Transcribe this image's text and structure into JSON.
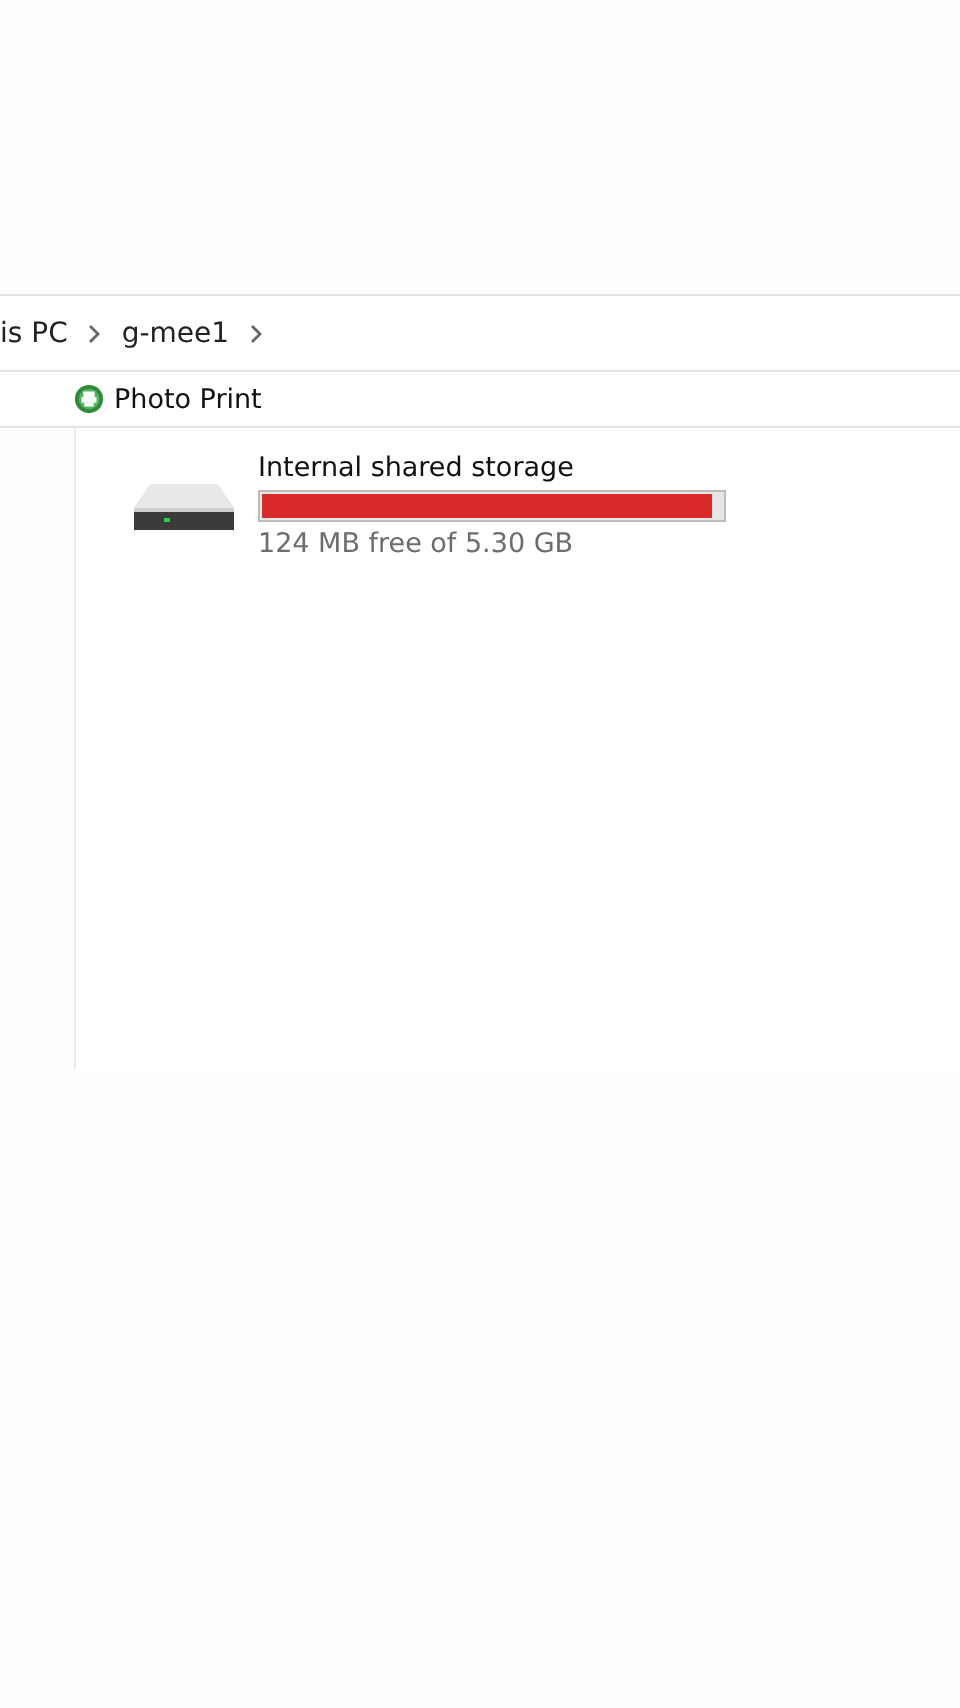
{
  "breadcrumb": {
    "items": [
      {
        "label": "is PC"
      },
      {
        "label": "g-mee1"
      }
    ]
  },
  "toolbar": {
    "items": [
      {
        "label": "Photo Print"
      }
    ]
  },
  "drives": [
    {
      "name": "Internal shared storage",
      "level": 0.98,
      "free_text": "124 MB free of 5.30 GB"
    }
  ]
}
